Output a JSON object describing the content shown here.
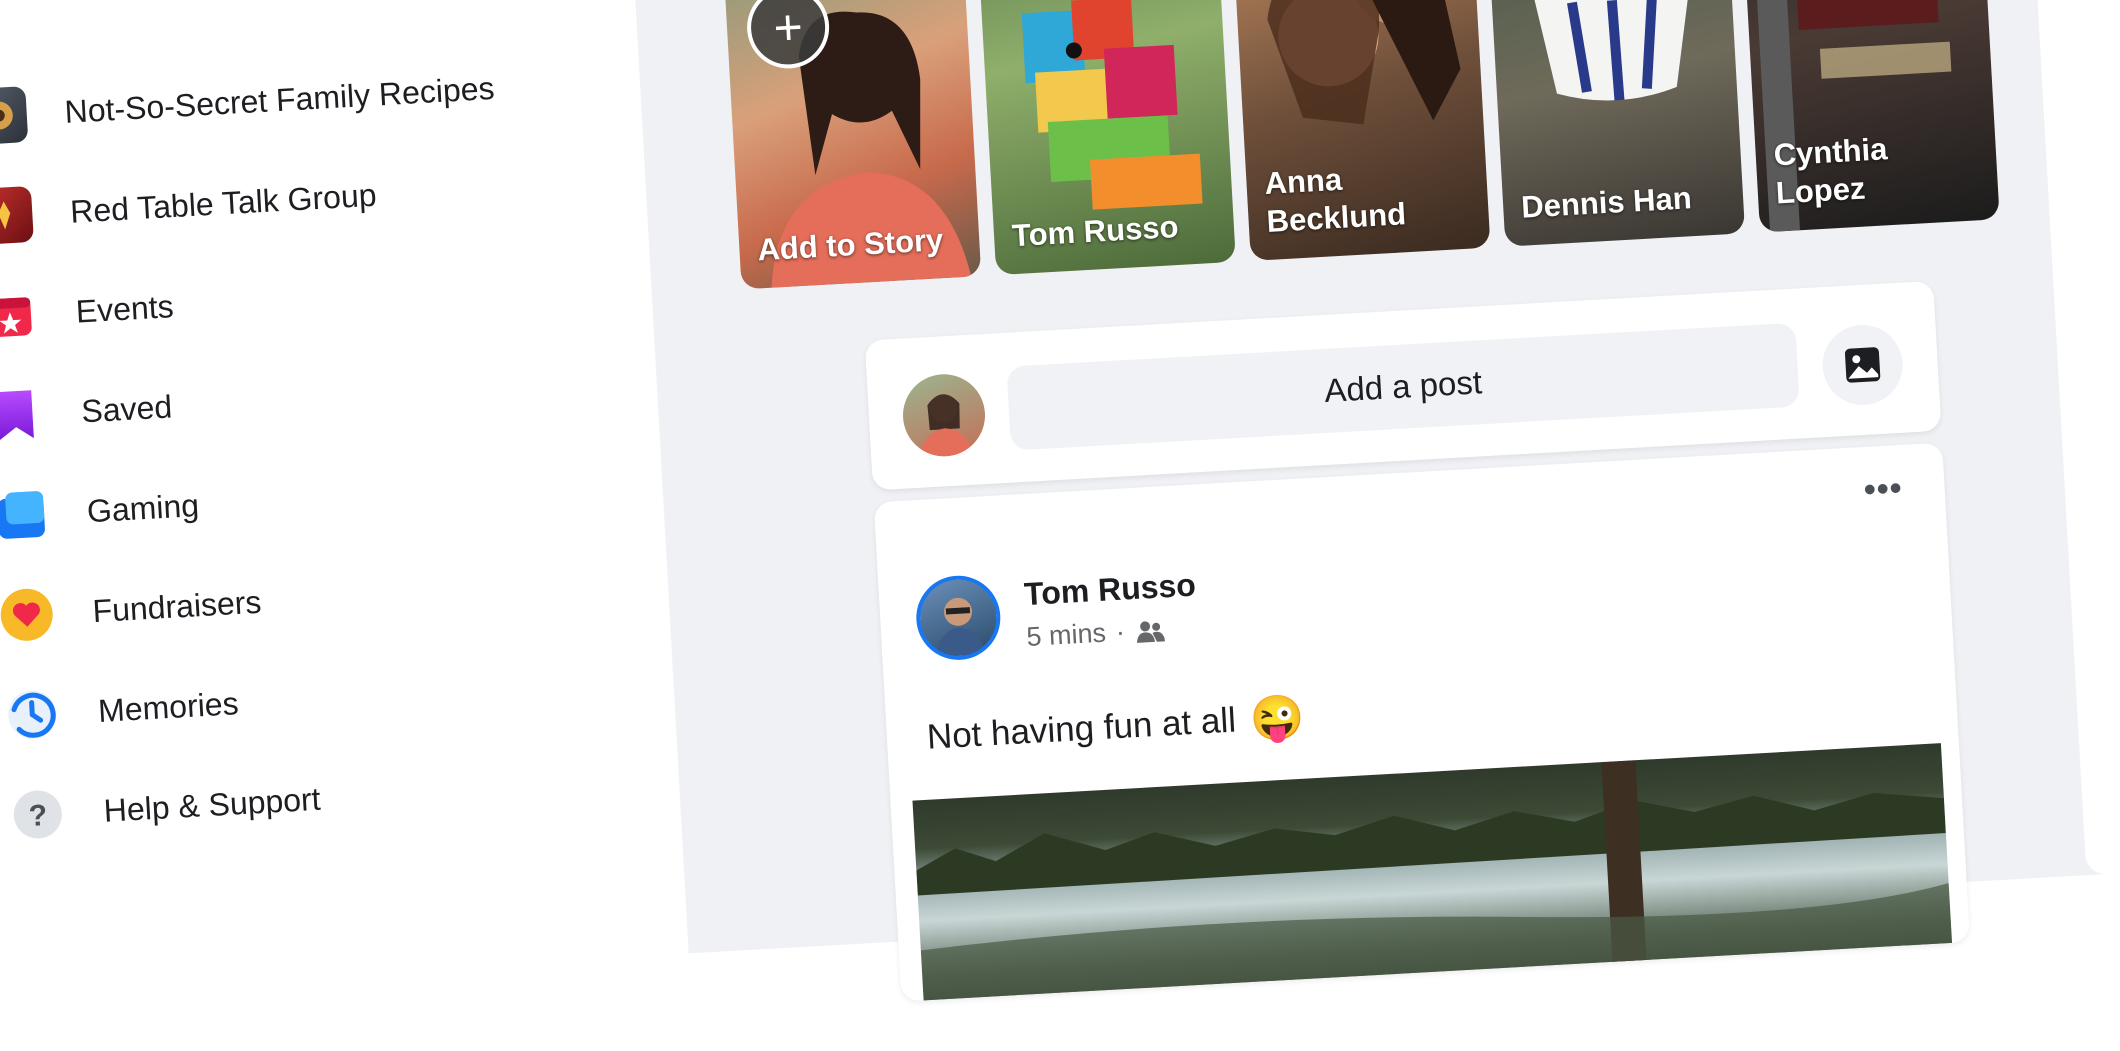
{
  "sidebar": {
    "items": [
      {
        "label": "Not-So-Secret Family Recipes",
        "icon": "group-avatar-icon"
      },
      {
        "label": "Red Table Talk Group",
        "icon": "group-avatar-icon"
      },
      {
        "label": "Events",
        "icon": "calendar-star-icon"
      },
      {
        "label": "Saved",
        "icon": "bookmark-icon"
      },
      {
        "label": "Gaming",
        "icon": "gaming-icon"
      },
      {
        "label": "Fundraisers",
        "icon": "heart-icon"
      },
      {
        "label": "Memories",
        "icon": "clock-icon"
      },
      {
        "label": "Help & Support",
        "icon": "question-icon"
      }
    ]
  },
  "stories": [
    {
      "label": "Add to Story",
      "icon": "plus-icon"
    },
    {
      "label": "Tom Russo"
    },
    {
      "label": "Anna Becklund"
    },
    {
      "label": "Dennis Han"
    },
    {
      "label": "Cynthia Lopez"
    }
  ],
  "composer": {
    "placeholder": "Add a post",
    "photo_icon": "photo-icon"
  },
  "post": {
    "author": "Tom Russo",
    "time": "5 mins",
    "separator": "·",
    "audience_icon": "friends-icon",
    "text": "Not having fun at all",
    "emoji": "😜",
    "more_icon": "more-options-icon"
  },
  "colors": {
    "feed_background": "#eff1f5",
    "card": "#ffffff",
    "text": "#1c1e21",
    "secondary_text": "#65676b",
    "events": "#f02849",
    "saved": "#a033ff",
    "gaming": "#1877f2",
    "fundraisers": "#f7b928"
  }
}
